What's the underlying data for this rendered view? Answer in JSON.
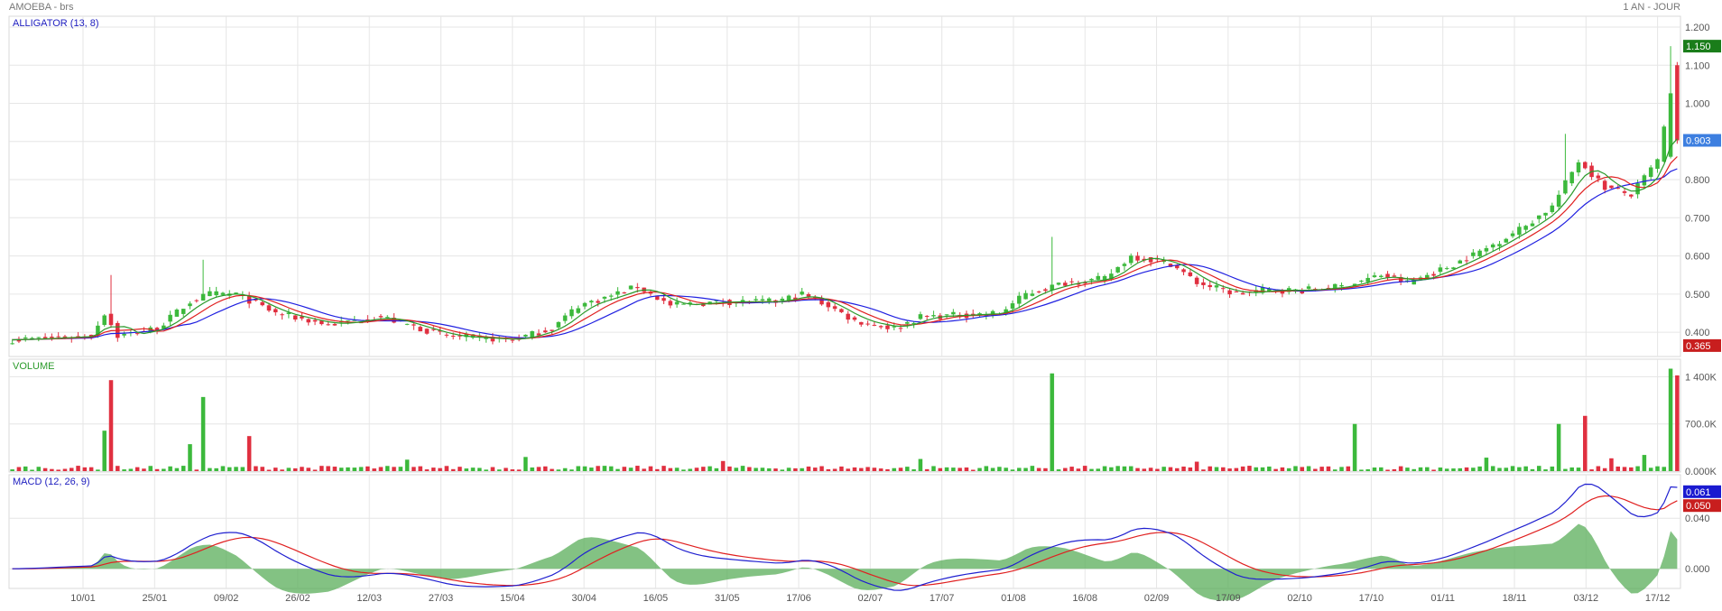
{
  "header": {
    "symbol": "AMOEBA - brs",
    "period": "1 AN - JOUR"
  },
  "colors": {
    "up": "#3cb93c",
    "down": "#e03040",
    "lips": "#2a9a2a",
    "teeth": "#e02020",
    "jaw": "#2020e0",
    "macd_line": "#2020d0",
    "signal_line": "#e02020",
    "histogram": "#5aad5a",
    "grid": "#e6e6e6",
    "axis_text": "#555555"
  },
  "chart_data": [
    {
      "panel": "price",
      "type": "candlestick",
      "title": "ALLIGATOR (13, 8)",
      "ylim": [
        0.36,
        1.2
      ],
      "y_ticks": [
        "1.200",
        "1.100",
        "1.000",
        "0.900",
        "0.800",
        "0.700",
        "0.600",
        "0.500",
        "0.400"
      ],
      "x_ticks": [
        "10/01",
        "25/01",
        "09/02",
        "26/02",
        "12/03",
        "27/03",
        "15/04",
        "30/04",
        "16/05",
        "31/05",
        "17/06",
        "02/07",
        "17/07",
        "01/08",
        "16/08",
        "02/09",
        "17/09",
        "02/10",
        "17/10",
        "01/11",
        "18/11",
        "03/12",
        "17/12"
      ],
      "price_marks": [
        {
          "label": "1.150",
          "value": 1.15,
          "color": "#1a7d1a"
        },
        {
          "label": "0.903",
          "value": 0.903,
          "color": "#3d7fe0"
        },
        {
          "label": "0.365",
          "value": 0.365,
          "color": "#c81e1e"
        }
      ],
      "close_anchors": [
        [
          0,
          0.38
        ],
        [
          12,
          0.39
        ],
        [
          14,
          0.45
        ],
        [
          16,
          0.39
        ],
        [
          22,
          0.41
        ],
        [
          27,
          0.48
        ],
        [
          30,
          0.5
        ],
        [
          34,
          0.5
        ],
        [
          40,
          0.45
        ],
        [
          48,
          0.42
        ],
        [
          56,
          0.44
        ],
        [
          66,
          0.39
        ],
        [
          76,
          0.38
        ],
        [
          82,
          0.41
        ],
        [
          86,
          0.47
        ],
        [
          90,
          0.49
        ],
        [
          95,
          0.52
        ],
        [
          100,
          0.47
        ],
        [
          108,
          0.48
        ],
        [
          116,
          0.48
        ],
        [
          120,
          0.5
        ],
        [
          124,
          0.47
        ],
        [
          128,
          0.43
        ],
        [
          134,
          0.41
        ],
        [
          138,
          0.44
        ],
        [
          150,
          0.45
        ],
        [
          154,
          0.5
        ],
        [
          160,
          0.53
        ],
        [
          166,
          0.54
        ],
        [
          170,
          0.6
        ],
        [
          176,
          0.58
        ],
        [
          180,
          0.53
        ],
        [
          186,
          0.5
        ],
        [
          190,
          0.51
        ],
        [
          196,
          0.51
        ],
        [
          202,
          0.52
        ],
        [
          208,
          0.55
        ],
        [
          212,
          0.53
        ],
        [
          218,
          0.57
        ],
        [
          224,
          0.62
        ],
        [
          230,
          0.68
        ],
        [
          234,
          0.73
        ],
        [
          238,
          0.85
        ],
        [
          242,
          0.78
        ],
        [
          246,
          0.76
        ],
        [
          250,
          0.85
        ],
        [
          252,
          1.02
        ],
        [
          253,
          0.903
        ]
      ],
      "highs_note": "spikes near 0.55 (early Jan), 0.59 (Feb), 0.65 (end Aug), 0.92 (late Nov), 1.150 (Dec)"
    },
    {
      "panel": "volume",
      "type": "bar",
      "title": "VOLUME",
      "ylim": [
        0,
        1500000
      ],
      "y_ticks": [
        "1 400K",
        "700.0K",
        "0.000K"
      ],
      "volume_spikes": [
        [
          14,
          600000
        ],
        [
          15,
          1350000
        ],
        [
          27,
          400000
        ],
        [
          29,
          1100000
        ],
        [
          36,
          520000
        ],
        [
          158,
          1450000
        ],
        [
          204,
          700000
        ],
        [
          235,
          700000
        ],
        [
          239,
          820000
        ],
        [
          252,
          1520000
        ],
        [
          253,
          1420000
        ]
      ]
    },
    {
      "panel": "macd",
      "type": "line",
      "title": "MACD (12, 26, 9)",
      "ylim": [
        -0.012,
        0.068
      ],
      "y_ticks": [
        "0.040",
        "0.000"
      ],
      "series": [
        {
          "name": "MACD",
          "last": "0.061"
        },
        {
          "name": "Signal",
          "last": "0.050"
        }
      ],
      "last_marks": [
        {
          "label": "0.061",
          "value": 0.061,
          "color": "#1a1ad0"
        },
        {
          "label": "0.050",
          "value": 0.05,
          "color": "#c81e1e"
        }
      ]
    }
  ]
}
